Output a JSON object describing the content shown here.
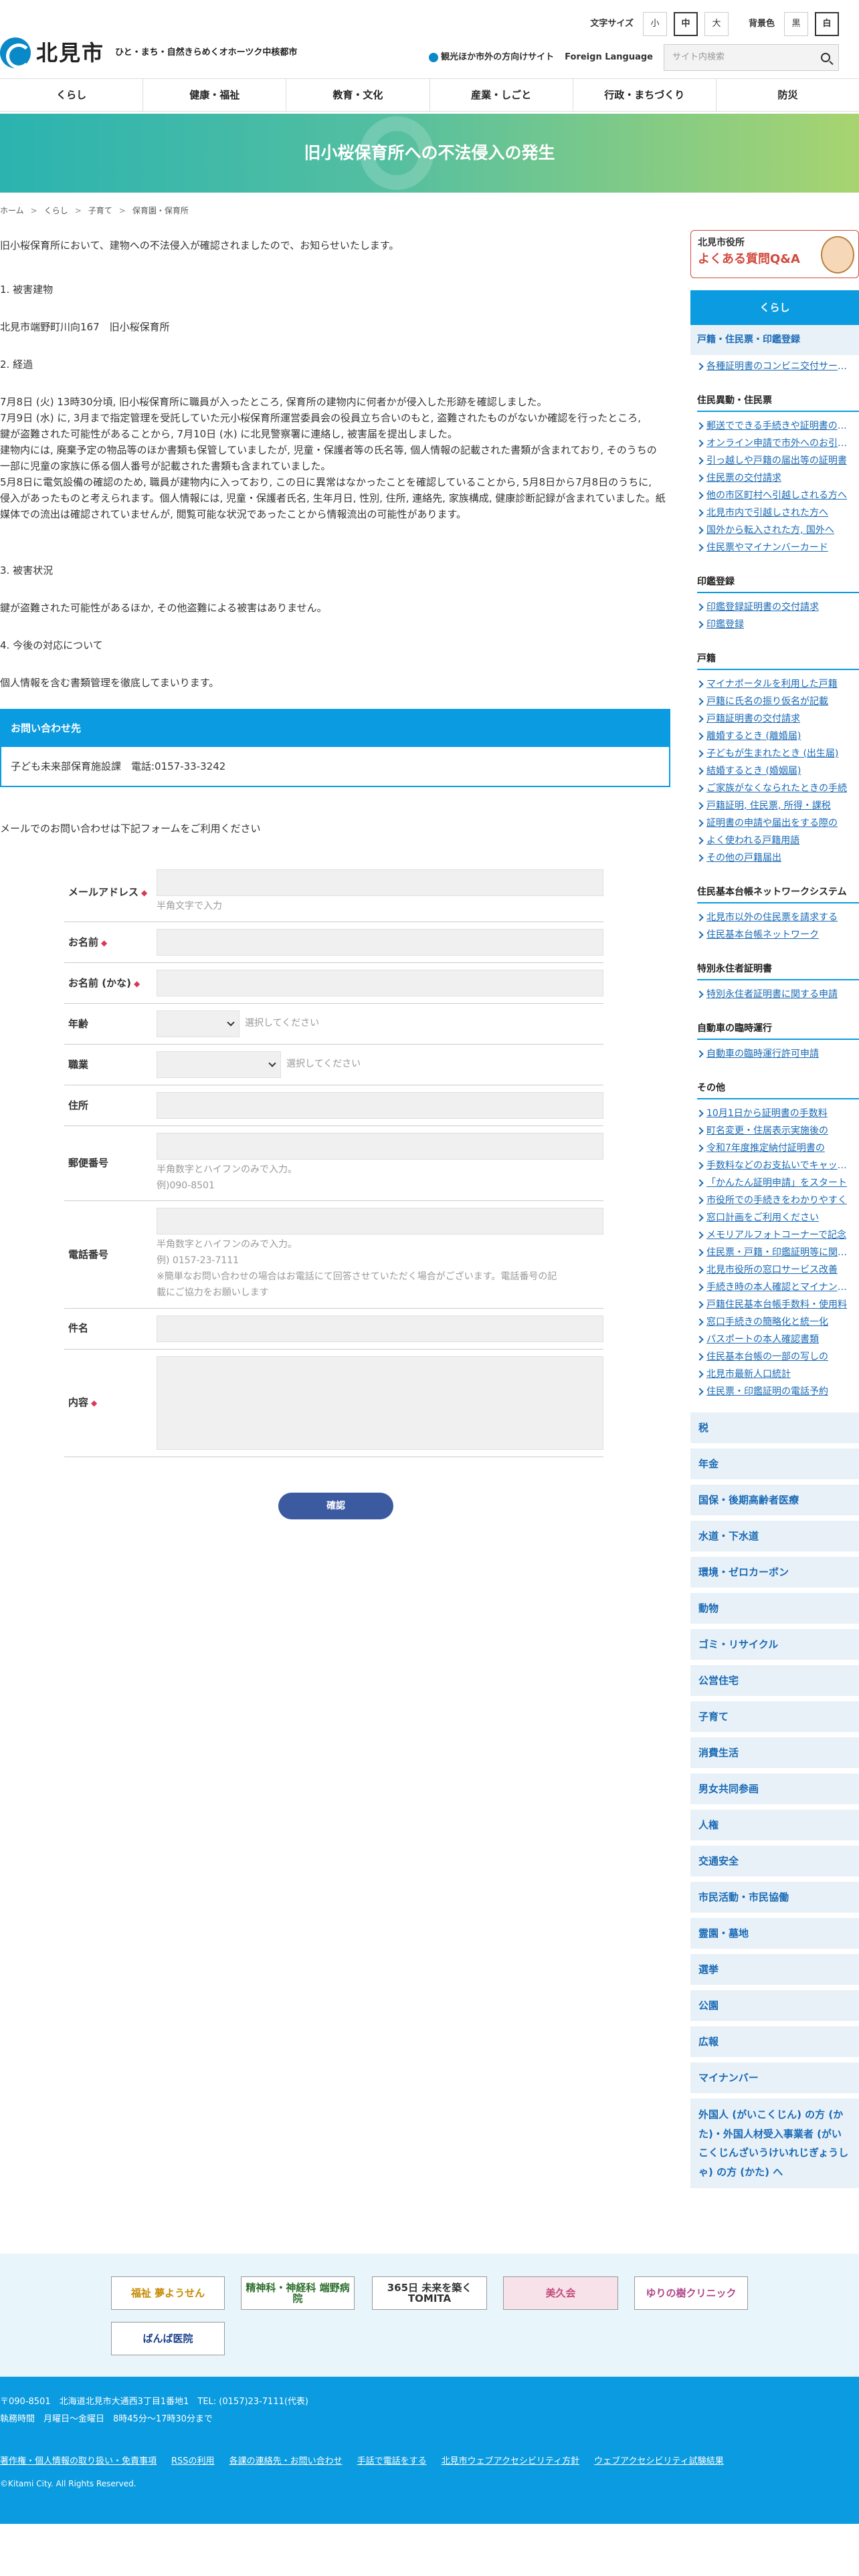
{
  "header": {
    "logo_text": "北見市",
    "tagline": "ひと・まち・自然きらめくオホーツク中核都市",
    "font_size_label": "文字サイズ",
    "font_sizes": [
      "小",
      "中",
      "大"
    ],
    "bg_color_label": "背景色",
    "bg_colors": [
      "黒",
      "白"
    ],
    "tourist_link": "観光ほか市外の方向けサイト",
    "foreign_language": "Foreign Language",
    "search_placeholder": "サイト内検索"
  },
  "gnav": [
    "くらし",
    "健康・福祉",
    "教育・文化",
    "産業・しごと",
    "行政・まちづくり",
    "防災"
  ],
  "page_title": "旧小桜保育所への不法侵入の発生",
  "breadcrumb": [
    "ホーム",
    "くらし",
    "子育て",
    "保育園・保育所"
  ],
  "body": {
    "intro": "旧小桜保育所において、建物への不法侵入が確認されましたので、お知らせいたします。",
    "h1": "1. 被害建物",
    "p1": "北見市端野町川向167　旧小桜保育所",
    "h2": "2. 経過",
    "p2a": "7月8日 (火) 13時30分頃, 旧小桜保育所に職員が入ったところ, 保育所の建物内に何者かが侵入した形跡を確認しました。",
    "p2b": "7月9日 (水) に, 3月まで指定管理を受託していた元小桜保育所運営委員会の役員立ち合いのもと, 盗難されたものがないか確認を行ったところ,",
    "p2c": "鍵が盗難された可能性があることから, 7月10日 (水) に北見警察署に連絡し, 被害届を提出しました。",
    "p2d": "建物内には, 廃棄予定の物品等のほか書類も保管していましたが, 児童・保護者等の氏名等, 個人情報の記載された書類が含まれており, そのうちの",
    "p2e": "一部に児童の家族に係る個人番号が記載された書類も含まれていました。",
    "p2f": "5月8日に電気設備の確認のため, 職員が建物内に入っており, この日に異常はなかったことを確認していることから, 5月8日から7月8日のうちに,",
    "p2g": "侵入があったものと考えられます。個人情報には, 児童・保護者氏名, 生年月日, 性別, 住所, 連絡先, 家族構成, 健康診断記録が含まれていました。紙",
    "p2h": "媒体での流出は確認されていませんが, 閲覧可能な状況であったことから情報流出の可能性があります。",
    "h3": "3. 被害状況",
    "p3": "鍵が盗難された可能性があるほか, その他盗難による被害はありません。",
    "h4": "4. 今後の対応について",
    "p4": "個人情報を含む書類管理を徹底してまいります。"
  },
  "contact": {
    "heading": "お問い合わせ先",
    "body": "子ども未来部保育施設課　電話:0157-33-3242"
  },
  "form": {
    "note": "メールでのお問い合わせは下記フォームをご利用ください",
    "email_label": "メールアドレス",
    "email_hint": "半角文字で入力",
    "name_label": "お名前",
    "kana_label": "お名前 (かな)",
    "age_label": "年齢",
    "age_hint": "選択してください",
    "job_label": "職業",
    "job_hint": "選択してください",
    "address_label": "住所",
    "zip_label": "郵便番号",
    "zip_hint1": "半角数字とハイフンのみで入力。",
    "zip_hint2": "例)090-8501",
    "tel_label": "電話番号",
    "tel_hint1": "半角数字とハイフンのみで入力。",
    "tel_hint2": "例) 0157-23-7111",
    "tel_hint3": "※簡単なお問い合わせの場合はお電話にて回答させていただく場合がございます。電話番号の記",
    "tel_hint4": "載にご協力をお願いします",
    "subject_label": "件名",
    "content_label": "内容",
    "required_mark": "◆",
    "confirm_button": "確認"
  },
  "sidebar": {
    "faq_small": "北見市役所",
    "faq_big": "よくある質問Q&A",
    "kurashi": "くらし",
    "sub_heading": "戸籍・住民票・印鑑登録",
    "top_links": [
      "各種証明書のコンビニ交付サービス"
    ],
    "groups": [
      {
        "title": "住民異動・住民票",
        "links": [
          "郵送でできる手続きや証明書の請求",
          "オンライン申請で市外へのお引越し",
          "引っ越しや戸籍の届出等の証明書",
          "住民票の交付請求",
          "他の市区町村へ引越しされる方へ",
          "北見市内で引越しされた方へ",
          "国外から転入された方, 国外へ",
          "住民票やマイナンバーカード"
        ]
      },
      {
        "title": "印鑑登録",
        "links": [
          "印鑑登録証明書の交付請求",
          "印鑑登録"
        ]
      },
      {
        "title": "戸籍",
        "links": [
          "マイナポータルを利用した戸籍",
          "戸籍に氏名の振り仮名が記載",
          "戸籍証明書の交付請求",
          "離婚するとき (離婚届)",
          "子どもが生まれたとき (出生届)",
          "結婚するとき (婚姻届)",
          "ご家族がなくなられたときの手続",
          "戸籍証明, 住民票, 所得・課税",
          "証明書の申請や届出をする際の",
          "よく使われる戸籍用語",
          "その他の戸籍届出"
        ]
      },
      {
        "title": "住民基本台帳ネットワークシステム",
        "links": [
          "北見市以外の住民票を請求する",
          "住民基本台帳ネットワーク"
        ]
      },
      {
        "title": "特別永住者証明書",
        "links": [
          "特別永住者証明書に関する申請"
        ]
      },
      {
        "title": "自動車の臨時運行",
        "links": [
          "自動車の臨時運行許可申請"
        ]
      },
      {
        "title": "その他",
        "links": [
          "10月1日から証明書の手数料",
          "町名変更・住居表示実施後の",
          "令和7年度推定納付証明書の",
          "手数料などのお支払いでキャッシュレス",
          "「かんたん証明申請」をスタート",
          "市役所での手続きをわかりやすく",
          "窓口計画をご利用ください",
          "メモリアルフォトコーナーで記念",
          "住民票・戸籍・印鑑証明等に関する",
          "北見市役所の窓口サービス改善",
          "手続き時の本人確認とマイナンバー",
          "戸籍住民基本台帳手数料・使用料",
          "窓口手続きの簡略化と統一化",
          "パスポートの本人確認書類",
          "住民基本台帳の一部の写しの",
          "北見市最新人口統計",
          "住民票・印鑑証明の電話予約"
        ]
      }
    ],
    "categories": [
      "税",
      "年金",
      "国保・後期高齢者医療",
      "水道・下水道",
      "環境・ゼロカーボン",
      "動物",
      "ゴミ・リサイクル",
      "公営住宅",
      "子育て",
      "消費生活",
      "男女共同参画",
      "人権",
      "交通安全",
      "市民活動・市民協働",
      "霊園・墓地",
      "選挙",
      "公園",
      "広報",
      "マイナンバー"
    ],
    "foreign_residents": "外国人 (がいこくじん) の方 (かた)・外国人材受入事業者 (がいこくじんざいうけいれじぎょうしゃ) の方 (かた) へ"
  },
  "sponsors": [
    "福祉 夢ようせん",
    "精神科・神経科 端野病院",
    "365日 未来を築く TOMITA",
    "美久会",
    "ゆりの樹クリニック",
    "ばんば医院"
  ],
  "footer": {
    "address": "〒090-8501　北海道北見市大通西3丁目1番地1　TEL: (0157)23-7111(代表)",
    "hours": "執務時間　月曜日～金曜日　8時45分～17時30分まで",
    "links": [
      "著作権・個人情報の取り扱い・免責事項",
      "RSSの利用",
      "各課の連絡先・お問い合わせ",
      "手話で電話をする",
      "北見市ウェブアクセシビリティ方針",
      "ウェブアクセシビリティ試験結果"
    ],
    "copyright": "©Kitami City. All Rights Reserved."
  }
}
